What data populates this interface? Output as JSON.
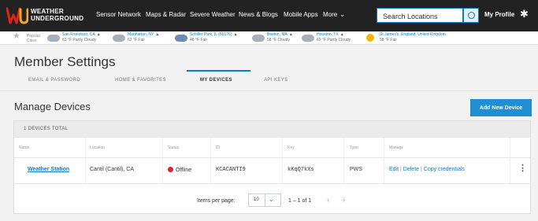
{
  "app": {
    "logo_line1": "WEATHER",
    "logo_line2": "UNDERGROUND"
  },
  "nav": {
    "items": [
      "Sensor Network",
      "Maps & Radar",
      "Severe Weather",
      "News & Blogs",
      "Mobile Apps",
      "More"
    ],
    "search_placeholder": "Search Locations",
    "profile": "My Profile"
  },
  "popular": {
    "label": "Popular Cities",
    "cities": [
      {
        "name": "San Francisco, CA",
        "cond": "63 °F Partly Cloudy"
      },
      {
        "name": "Manhattan, NY",
        "cond": "62 °F Fair"
      },
      {
        "name": "Schiller Park, IL (60176)",
        "cond": "46 °F Fair"
      },
      {
        "name": "Boston, MA",
        "cond": "58 °F Cloudy"
      },
      {
        "name": "Houston, TX",
        "cond": "69 °F Partly Cloudy"
      },
      {
        "name": "St James's, England, United Kingdom",
        "cond": "58 °F Fair"
      }
    ]
  },
  "page": {
    "title": "Member Settings",
    "tabs": [
      "EMAIL & PASSWORD",
      "HOME & FAVORITES",
      "MY DEVICES",
      "API KEYS"
    ],
    "active_tab": "MY DEVICES"
  },
  "devices": {
    "heading": "Manage Devices",
    "add_button": "Add New Device",
    "total_label": "1 DEVICES TOTAL",
    "columns": [
      "Name",
      "Location",
      "Status",
      "ID",
      "Key",
      "Type",
      "Manage"
    ],
    "rows": [
      {
        "name": "Weather Station",
        "location": "Cantil (Cantil), CA",
        "status": "Offline",
        "id": "KCACANTI9",
        "key": "kKqQ7kXs",
        "type": "PWS",
        "actions": [
          "Edit",
          "Delete",
          "Copy credentials"
        ]
      }
    ],
    "pagination": {
      "items_per_page_label": "Items per page:",
      "items_per_page": "10",
      "range": "1 – 1 of 1"
    }
  },
  "colors": {
    "accent": "#0d7ac7",
    "button": "#1e8fd5",
    "offline": "#d9262d",
    "topbar": "#222222"
  }
}
